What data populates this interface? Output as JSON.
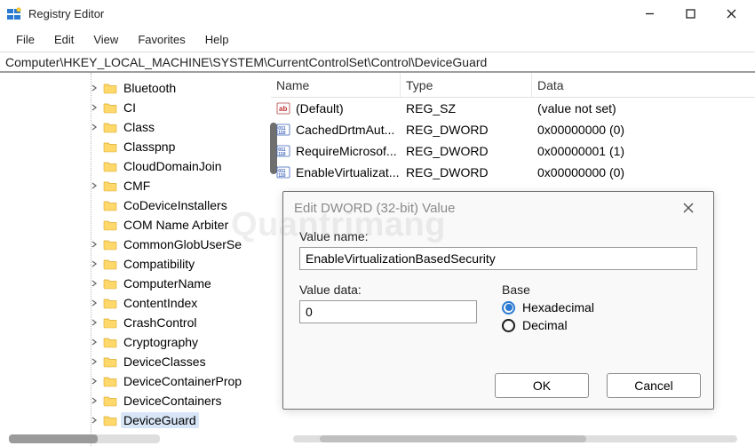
{
  "app": {
    "title": "Registry Editor"
  },
  "menus": [
    "File",
    "Edit",
    "View",
    "Favorites",
    "Help"
  ],
  "address": "Computer\\HKEY_LOCAL_MACHINE\\SYSTEM\\CurrentControlSet\\Control\\DeviceGuard",
  "tree": [
    {
      "label": "Bluetooth",
      "expandable": true
    },
    {
      "label": "CI",
      "expandable": true
    },
    {
      "label": "Class",
      "expandable": true
    },
    {
      "label": "Classpnp",
      "expandable": false
    },
    {
      "label": "CloudDomainJoin",
      "expandable": false
    },
    {
      "label": "CMF",
      "expandable": true
    },
    {
      "label": "CoDeviceInstallers",
      "expandable": false
    },
    {
      "label": "COM Name Arbiter",
      "expandable": false
    },
    {
      "label": "CommonGlobUserSe",
      "expandable": true
    },
    {
      "label": "Compatibility",
      "expandable": true
    },
    {
      "label": "ComputerName",
      "expandable": true
    },
    {
      "label": "ContentIndex",
      "expandable": true
    },
    {
      "label": "CrashControl",
      "expandable": true
    },
    {
      "label": "Cryptography",
      "expandable": true
    },
    {
      "label": "DeviceClasses",
      "expandable": true
    },
    {
      "label": "DeviceContainerProp",
      "expandable": true
    },
    {
      "label": "DeviceContainers",
      "expandable": true
    },
    {
      "label": "DeviceGuard",
      "expandable": true,
      "selected": true
    }
  ],
  "list": {
    "columns": {
      "name": "Name",
      "type": "Type",
      "data": "Data"
    },
    "rows": [
      {
        "icon": "string",
        "name": "(Default)",
        "type": "REG_SZ",
        "data": "(value not set)"
      },
      {
        "icon": "dword",
        "name": "CachedDrtmAut...",
        "type": "REG_DWORD",
        "data": "0x00000000 (0)"
      },
      {
        "icon": "dword",
        "name": "RequireMicrosof...",
        "type": "REG_DWORD",
        "data": "0x00000001 (1)"
      },
      {
        "icon": "dword",
        "name": "EnableVirtualizat...",
        "type": "REG_DWORD",
        "data": "0x00000000 (0)"
      }
    ]
  },
  "dialog": {
    "title": "Edit DWORD (32-bit) Value",
    "value_name_label": "Value name:",
    "value_name": "EnableVirtualizationBasedSecurity",
    "value_data_label": "Value data:",
    "value_data": "0",
    "base_label": "Base",
    "base_hex": "Hexadecimal",
    "base_dec": "Decimal",
    "base_selected": "hex",
    "ok": "OK",
    "cancel": "Cancel"
  },
  "watermark": "Quantrimang"
}
